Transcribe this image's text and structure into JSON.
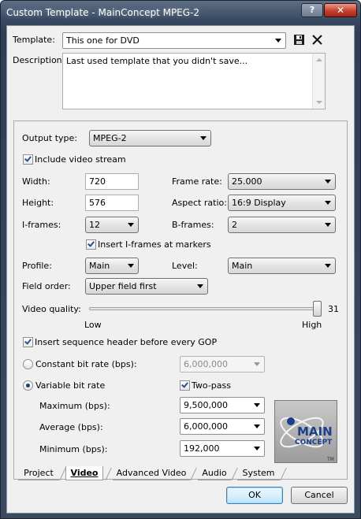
{
  "window": {
    "title": "Custom Template - MainConcept MPEG-2",
    "help_label": "?",
    "close_label": "✕"
  },
  "template": {
    "label": "Template:",
    "value": "This one for DVD"
  },
  "description": {
    "label": "Description:",
    "value": "Last used template that you didn't save..."
  },
  "video": {
    "output_type": {
      "label": "Output type:",
      "value": "MPEG-2"
    },
    "include_video": {
      "label": "Include video stream",
      "checked": true
    },
    "width": {
      "label": "Width:",
      "value": "720"
    },
    "height": {
      "label": "Height:",
      "value": "576"
    },
    "frame_rate": {
      "label": "Frame rate:",
      "value": "25.000"
    },
    "aspect_ratio": {
      "label": "Aspect ratio:",
      "value": "16:9 Display"
    },
    "i_frames": {
      "label": "I-frames:",
      "value": "12"
    },
    "b_frames": {
      "label": "B-frames:",
      "value": "2"
    },
    "insert_iframes": {
      "label": "Insert I-frames at markers",
      "checked": true
    },
    "profile": {
      "label": "Profile:",
      "value": "Main"
    },
    "level": {
      "label": "Level:",
      "value": "Main"
    },
    "field_order": {
      "label": "Field order:",
      "value": "Upper field first"
    },
    "video_quality": {
      "label": "Video quality:",
      "value": "31",
      "low_label": "Low",
      "high_label": "High",
      "fraction": 1.0
    },
    "insert_seq_header": {
      "label": "Insert sequence header before every GOP",
      "checked": true
    },
    "cbr": {
      "label": "Constant bit rate (bps):",
      "value": "6,000,000",
      "selected": false
    },
    "vbr": {
      "label": "Variable bit rate",
      "selected": true
    },
    "two_pass": {
      "label": "Two-pass",
      "checked": true
    },
    "maximum": {
      "label": "Maximum (bps):",
      "value": "9,500,000"
    },
    "average": {
      "label": "Average (bps):",
      "value": "6,000,000"
    },
    "minimum": {
      "label": "Minimum (bps):",
      "value": "192,000"
    },
    "logo": {
      "line1": "MAIN",
      "line2": "CONCEPT",
      "mark": "TM"
    }
  },
  "tabs": [
    "Project",
    "Video",
    "Advanced Video",
    "Audio",
    "System"
  ],
  "active_tab": "Video",
  "buttons": {
    "ok": "OK",
    "cancel": "Cancel"
  },
  "colors": {
    "title_bar": "#384a63",
    "close_button": "#c8402c",
    "client": "#f0f0f0"
  }
}
